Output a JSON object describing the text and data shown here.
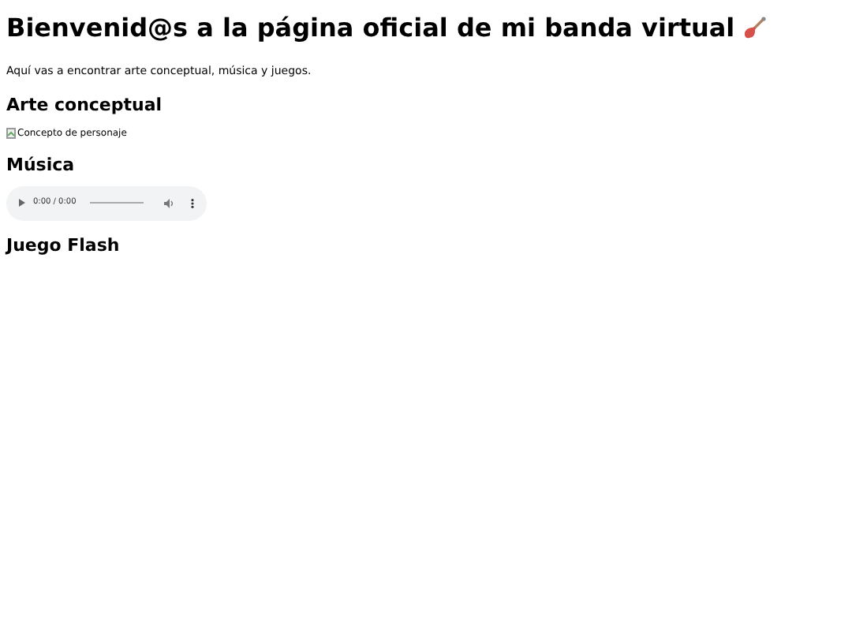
{
  "title": "Bienvenid@s a la página oficial de mi banda virtual",
  "intro": "Aquí vas a encontrar arte conceptual, música y juegos.",
  "sections": [
    {
      "kind": "image",
      "heading": "Arte conceptual",
      "alt": "Concepto de personaje"
    },
    {
      "kind": "audio",
      "heading": "Música",
      "time": "0:00 / 0:00"
    },
    {
      "kind": "empty",
      "heading": "Juego Flash"
    }
  ]
}
